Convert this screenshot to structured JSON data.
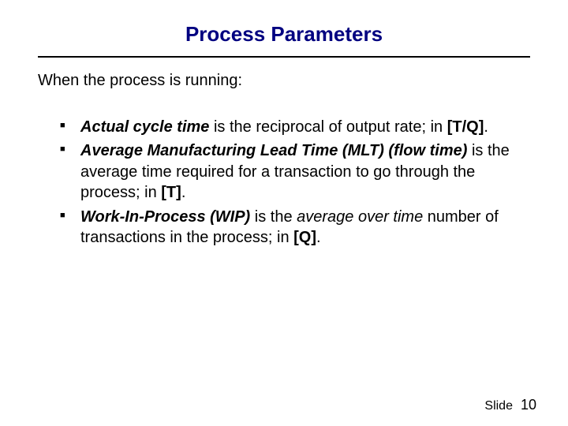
{
  "title": "Process Parameters",
  "intro": "When the process is running:",
  "bullets": [
    {
      "term": "Actual cycle time",
      "rest1": " is the reciprocal of output rate; in ",
      "unit": "[T/Q]",
      "rest2": "."
    },
    {
      "term": "Average Manufacturing Lead Time (MLT)",
      "paren": " (flow time)",
      "rest1": " is the average time required for a transaction to go through the process; in ",
      "unit": "[T]",
      "rest2": "."
    },
    {
      "term": "Work-In-Process (WIP)",
      "rest1a": " is the ",
      "em": "average over time",
      "rest1b": " number of transactions in the process; in ",
      "unit": "[Q]",
      "rest2": "."
    }
  ],
  "footer": {
    "label": "Slide",
    "number": "10"
  }
}
